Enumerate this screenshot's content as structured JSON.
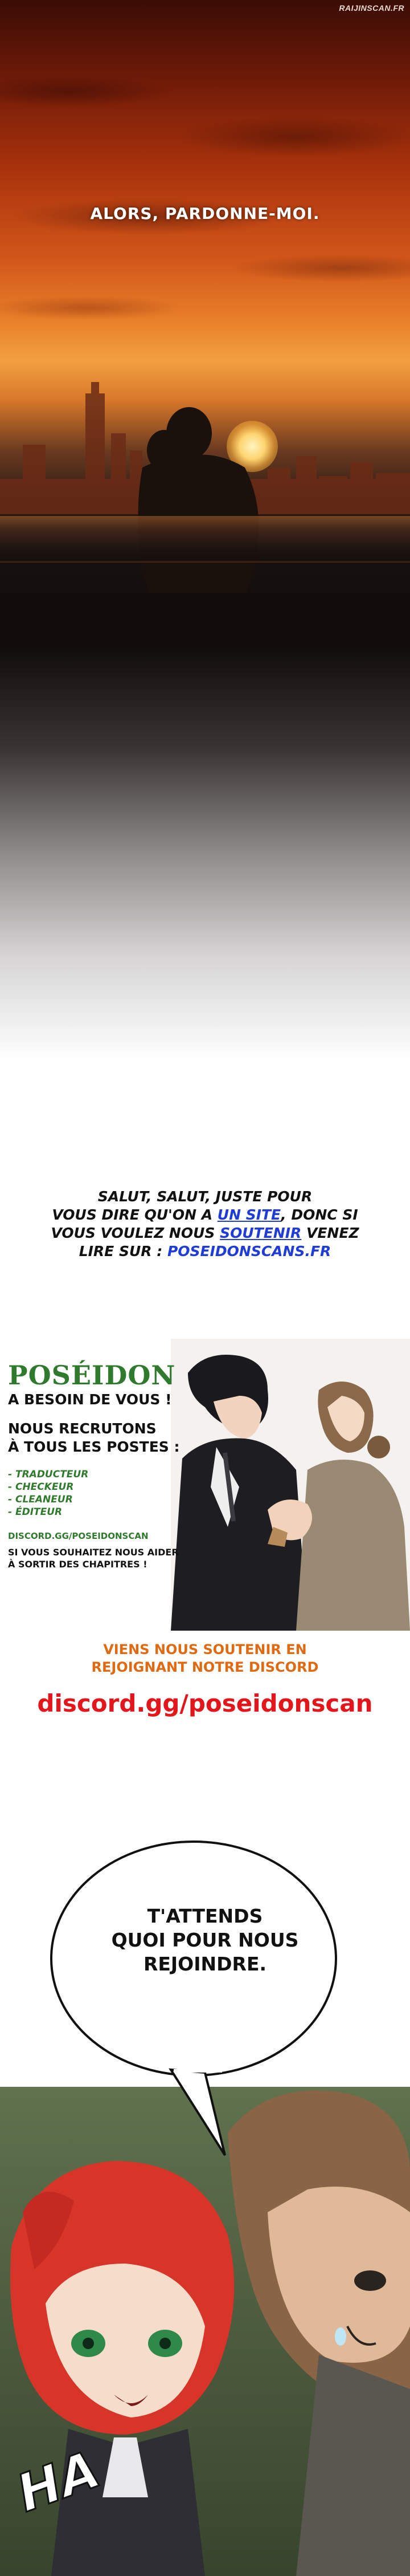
{
  "watermark": "RAIJINSCAN.FR",
  "panel1": {
    "caption": "ALORS, PARDONNE-MOI."
  },
  "promo": {
    "line1": "SALUT, SALUT, JUSTE POUR",
    "line2_a": "VOUS DIRE QU'ON A ",
    "line2_link": "UN SITE",
    "line2_b": ", DONC SI",
    "line3_a": "VOUS VOULEZ NOUS ",
    "line3_link": "SOUTENIR",
    "line3_b": " VENEZ",
    "line4_a": "LIRE SUR : ",
    "line4_link": "POSEIDONSCANS.FR"
  },
  "banner": {
    "title": "POSÉIDON",
    "subtitle": "A BESOIN DE VOUS !",
    "recruit_line1": "NOUS RECRUTONS",
    "recruit_line2": "À TOUS LES POSTES :",
    "roles": [
      "- TRADUCTEUR",
      "- CHECKEUR",
      "- CLEANEUR",
      "- ÉDITEUR"
    ],
    "discord": "DISCORD.GG/POSEIDONSCAN",
    "help_line1": "SI VOUS SOUHAITEZ NOUS AIDER",
    "help_line2": "À SORTIR DES CHAPITRES !"
  },
  "discord_callout": {
    "line1": "VIENS NOUS SOUTENIR EN",
    "line2": "REJOIGNANT NOTRE DISCORD",
    "link": "discord.gg/poseidonscan"
  },
  "finale": {
    "bubble_line1": "T'ATTENDS",
    "bubble_line2": "QUOI POUR NOUS",
    "bubble_line3": "REJOINDRE.",
    "sfx": "HA"
  },
  "colors": {
    "accent_green": "#2f7a2c",
    "link_blue": "#1f3bd8",
    "callout_orange": "#e06a12",
    "callout_red": "#e3161c",
    "hair_red": "#d8352a"
  }
}
